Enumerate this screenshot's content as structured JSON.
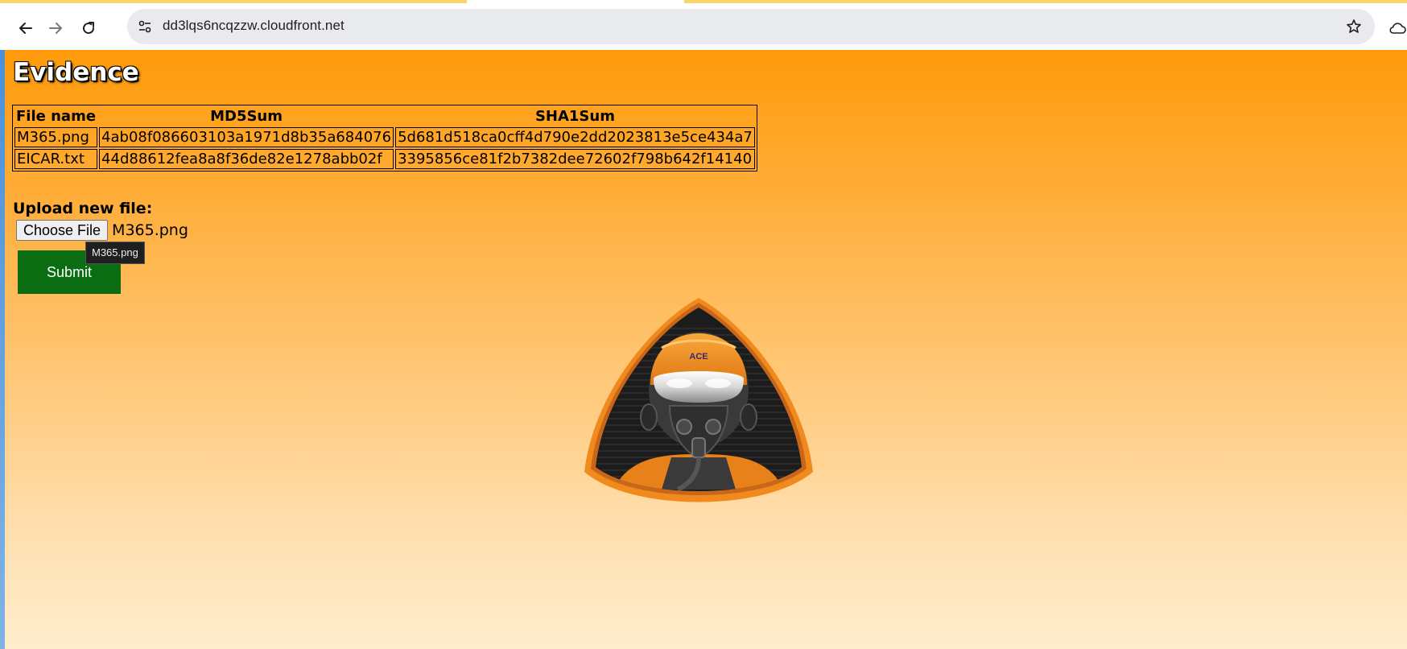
{
  "browser": {
    "url": "dd3lqs6ncqzzw.cloudfront.net",
    "icons": {
      "back": "arrow-left-icon",
      "forward": "arrow-right-icon",
      "reload": "reload-icon",
      "site_info": "tune-icon",
      "bookmark": "star-icon",
      "profile": "cloud-icon"
    }
  },
  "page": {
    "title": "Evidence",
    "table": {
      "headers": [
        "File name",
        "MD5Sum",
        "SHA1Sum"
      ],
      "rows": [
        [
          "M365.png",
          "4ab08f086603103a1971d8b35a684076",
          "5d681d518ca0cff4d790e2dd2023813e5ce434a7"
        ],
        [
          "EICAR.txt",
          "44d88612fea8a8f36de82e1278abb02f",
          "3395856ce81f2b7382dee72602f798b642f14140"
        ]
      ]
    },
    "upload": {
      "label": "Upload new file:",
      "choose_button": "Choose File",
      "selected_file": "M365.png",
      "tooltip": "M365.png",
      "submit_label": "Submit"
    },
    "badge": {
      "helmet_text": "ACE"
    }
  },
  "colors": {
    "page_gradient_top": "#ff9a0a",
    "page_gradient_bottom": "#ffeccc",
    "submit_bg": "#0b6d12",
    "badge_border": "#f08a1c"
  }
}
